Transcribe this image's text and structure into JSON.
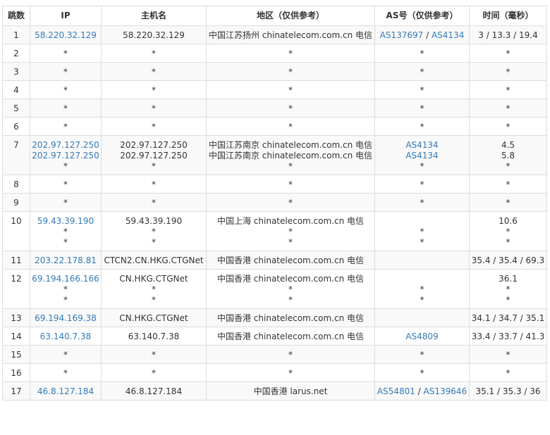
{
  "headers": [
    "跳数",
    "IP",
    "主机名",
    "地区（仅供参考）",
    "AS号（仅供参考）",
    "时间（毫秒）"
  ],
  "colors": {
    "link": "#337ab7",
    "text": "#333333",
    "border": "#dddddd",
    "stripe": "#f9f9f9"
  },
  "rows": [
    {
      "hop": "1",
      "ip": [
        "58.220.32.129"
      ],
      "host": [
        "58.220.32.129"
      ],
      "region": [
        "中国江苏扬州 chinatelecom.com.cn 电信"
      ],
      "as": [
        [
          "AS137697",
          "AS4134"
        ]
      ],
      "time": [
        "3 / 13.3 / 19.4"
      ]
    },
    {
      "hop": "2",
      "ip": [
        "*"
      ],
      "host": [
        "*"
      ],
      "region": [
        "*"
      ],
      "as": [
        [
          "*"
        ]
      ],
      "time": [
        "*"
      ]
    },
    {
      "hop": "3",
      "ip": [
        "*"
      ],
      "host": [
        "*"
      ],
      "region": [
        "*"
      ],
      "as": [
        [
          "*"
        ]
      ],
      "time": [
        "*"
      ]
    },
    {
      "hop": "4",
      "ip": [
        "*"
      ],
      "host": [
        "*"
      ],
      "region": [
        "*"
      ],
      "as": [
        [
          "*"
        ]
      ],
      "time": [
        "*"
      ]
    },
    {
      "hop": "5",
      "ip": [
        "*"
      ],
      "host": [
        "*"
      ],
      "region": [
        "*"
      ],
      "as": [
        [
          "*"
        ]
      ],
      "time": [
        "*"
      ]
    },
    {
      "hop": "6",
      "ip": [
        "*"
      ],
      "host": [
        "*"
      ],
      "region": [
        "*"
      ],
      "as": [
        [
          "*"
        ]
      ],
      "time": [
        "*"
      ]
    },
    {
      "hop": "7",
      "ip": [
        "202.97.127.250",
        "202.97.127.250",
        "*"
      ],
      "host": [
        "202.97.127.250",
        "202.97.127.250",
        "*"
      ],
      "region": [
        "中国江苏南京 chinatelecom.com.cn 电信",
        "中国江苏南京 chinatelecom.com.cn 电信",
        "*"
      ],
      "as": [
        [
          "AS4134"
        ],
        [
          "AS4134"
        ],
        [
          "*"
        ]
      ],
      "time": [
        "4.5",
        "5.8",
        "*"
      ]
    },
    {
      "hop": "8",
      "ip": [
        "*"
      ],
      "host": [
        "*"
      ],
      "region": [
        "*"
      ],
      "as": [
        [
          "*"
        ]
      ],
      "time": [
        "*"
      ]
    },
    {
      "hop": "9",
      "ip": [
        "*"
      ],
      "host": [
        "*"
      ],
      "region": [
        "*"
      ],
      "as": [
        [
          "*"
        ]
      ],
      "time": [
        "*"
      ]
    },
    {
      "hop": "10",
      "ip": [
        "59.43.39.190",
        "*",
        "*"
      ],
      "host": [
        "59.43.39.190",
        "*",
        "*"
      ],
      "region": [
        "中国上海 chinatelecom.com.cn 电信",
        "*",
        "*"
      ],
      "as": [
        [
          ""
        ],
        [
          "*"
        ],
        [
          "*"
        ]
      ],
      "time": [
        "10.6",
        "*",
        "*"
      ]
    },
    {
      "hop": "11",
      "ip": [
        "203.22.178.81"
      ],
      "host": [
        "CTCN2.CN.HKG.CTGNet"
      ],
      "region": [
        "中国香港 chinatelecom.com.cn 电信"
      ],
      "as": [
        [
          ""
        ]
      ],
      "time": [
        "35.4 / 35.4 / 69.3"
      ]
    },
    {
      "hop": "12",
      "ip": [
        "69.194.166.166",
        "*",
        "*"
      ],
      "host": [
        "CN.HKG.CTGNet",
        "*",
        "*"
      ],
      "region": [
        "中国香港 chinatelecom.com.cn 电信",
        "*",
        "*"
      ],
      "as": [
        [
          ""
        ],
        [
          "*"
        ],
        [
          "*"
        ]
      ],
      "time": [
        "36.1",
        "*",
        "*"
      ]
    },
    {
      "hop": "13",
      "ip": [
        "69.194.169.38"
      ],
      "host": [
        "CN.HKG.CTGNet"
      ],
      "region": [
        "中国香港 chinatelecom.com.cn 电信"
      ],
      "as": [
        [
          ""
        ]
      ],
      "time": [
        "34.1 / 34.7 / 35.1"
      ]
    },
    {
      "hop": "14",
      "ip": [
        "63.140.7.38"
      ],
      "host": [
        "63.140.7.38"
      ],
      "region": [
        "中国香港 chinatelecom.com.cn 电信"
      ],
      "as": [
        [
          "AS4809"
        ]
      ],
      "time": [
        "33.4 / 33.7 / 41.3"
      ]
    },
    {
      "hop": "15",
      "ip": [
        "*"
      ],
      "host": [
        "*"
      ],
      "region": [
        "*"
      ],
      "as": [
        [
          "*"
        ]
      ],
      "time": [
        "*"
      ]
    },
    {
      "hop": "16",
      "ip": [
        "*"
      ],
      "host": [
        "*"
      ],
      "region": [
        "*"
      ],
      "as": [
        [
          "*"
        ]
      ],
      "time": [
        "*"
      ]
    },
    {
      "hop": "17",
      "ip": [
        "46.8.127.184"
      ],
      "host": [
        "46.8.127.184"
      ],
      "region": [
        "中国香港 larus.net"
      ],
      "as": [
        [
          "AS54801",
          "AS139646"
        ]
      ],
      "time": [
        "35.1 / 35.3 / 36"
      ]
    }
  ]
}
